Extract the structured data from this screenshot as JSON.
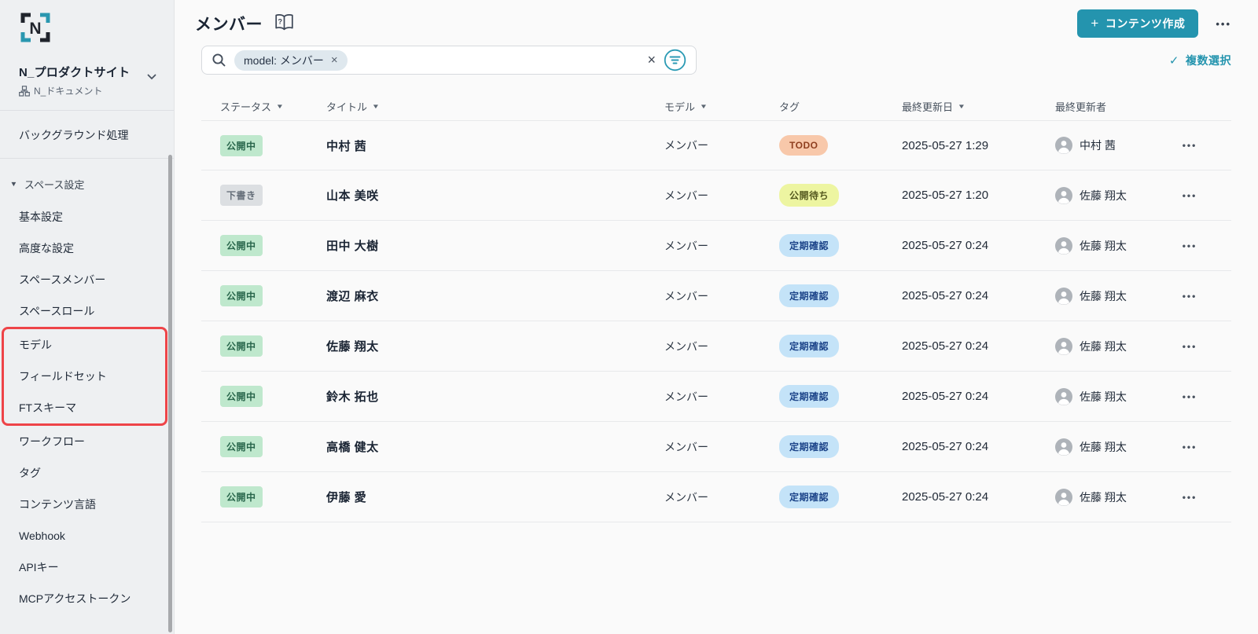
{
  "sidebar": {
    "workspace_name": "N_プロダクトサイト",
    "workspace_sub": "N_ドキュメント",
    "background_item": "バックグラウンド処理",
    "section_label": "スペース設定",
    "items": [
      "基本設定",
      "高度な設定",
      "スペースメンバー",
      "スペースロール"
    ],
    "highlighted_items": [
      "モデル",
      "フィールドセット",
      "FTスキーマ"
    ],
    "items_after": [
      "ワークフロー",
      "タグ",
      "コンテンツ言語",
      "Webhook",
      "APIキー",
      "MCPアクセストークン"
    ]
  },
  "header": {
    "title": "メンバー",
    "create_plus": "+",
    "create_label": "コンテンツ作成"
  },
  "search": {
    "chip_label": "model: メンバー",
    "chip_remove": "×",
    "clear_glyph": "×",
    "multi_select_label": "複数選択",
    "check_glyph": "✓"
  },
  "table": {
    "columns": [
      {
        "label": "ステータス",
        "sortable": true
      },
      {
        "label": "タイトル",
        "sortable": true
      },
      {
        "label": "モデル",
        "sortable": true
      },
      {
        "label": "タグ",
        "sortable": false
      },
      {
        "label": "最終更新日",
        "sortable": true
      },
      {
        "label": "最終更新者",
        "sortable": false
      }
    ],
    "rows": [
      {
        "status": "公開中",
        "status_type": "published",
        "title": "中村 茜",
        "model": "メンバー",
        "tag": "TODO",
        "updated": "2025-05-27 1:29",
        "updater": "中村 茜"
      },
      {
        "status": "下書き",
        "status_type": "draft",
        "title": "山本 美咲",
        "model": "メンバー",
        "tag": "公開待ち",
        "updated": "2025-05-27 1:20",
        "updater": "佐藤 翔太"
      },
      {
        "status": "公開中",
        "status_type": "published",
        "title": "田中 大樹",
        "model": "メンバー",
        "tag": "定期確認",
        "updated": "2025-05-27 0:24",
        "updater": "佐藤 翔太"
      },
      {
        "status": "公開中",
        "status_type": "published",
        "title": "渡辺 麻衣",
        "model": "メンバー",
        "tag": "定期確認",
        "updated": "2025-05-27 0:24",
        "updater": "佐藤 翔太"
      },
      {
        "status": "公開中",
        "status_type": "published",
        "title": "佐藤 翔太",
        "model": "メンバー",
        "tag": "定期確認",
        "updated": "2025-05-27 0:24",
        "updater": "佐藤 翔太"
      },
      {
        "status": "公開中",
        "status_type": "published",
        "title": "鈴木 拓也",
        "model": "メンバー",
        "tag": "定期確認",
        "updated": "2025-05-27 0:24",
        "updater": "佐藤 翔太"
      },
      {
        "status": "公開中",
        "status_type": "published",
        "title": "高橋 健太",
        "model": "メンバー",
        "tag": "定期確認",
        "updated": "2025-05-27 0:24",
        "updater": "佐藤 翔太"
      },
      {
        "status": "公開中",
        "status_type": "published",
        "title": "伊藤 愛",
        "model": "メンバー",
        "tag": "定期確認",
        "updated": "2025-05-27 0:24",
        "updater": "佐藤 翔太"
      }
    ]
  },
  "colors": {
    "accent_teal": "#2494ae",
    "annotation_red": "#ee4448",
    "status": {
      "published": {
        "bg": "#bfe8cd",
        "fg": "#27654a"
      },
      "draft": {
        "bg": "#dcdfe2",
        "fg": "#666f7a"
      }
    },
    "tag": {
      "TODO": {
        "bg": "#f8c8aa",
        "fg": "#8f3f1f"
      },
      "公開待ち": {
        "bg": "#edf5a1",
        "fg": "#55591f"
      },
      "定期確認": {
        "bg": "#c4e3f8",
        "fg": "#1c4489"
      }
    }
  }
}
